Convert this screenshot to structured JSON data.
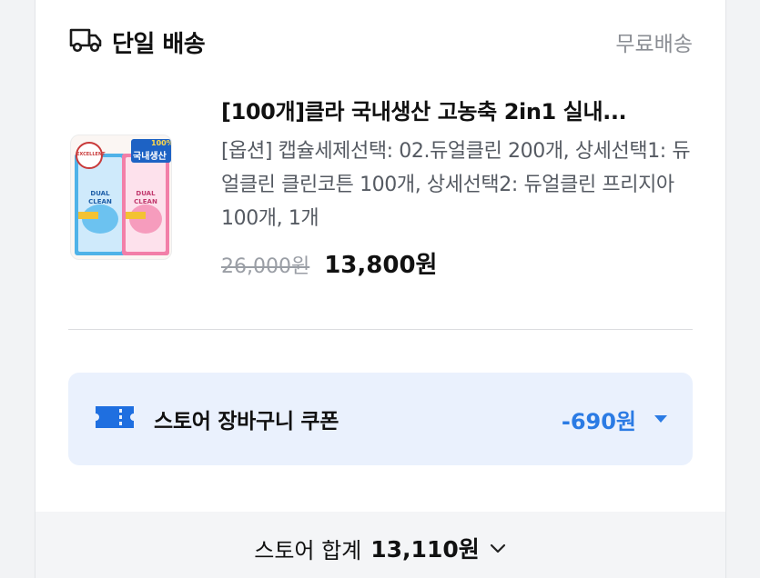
{
  "shipping": {
    "title": "단일 배송",
    "fee": "무료배송",
    "icon": "truck-icon"
  },
  "product": {
    "name": "[100개]클라 국내생산 고농축 2in1 실내...",
    "options": "[옵션] 캡슐세제선택: 02.듀얼클린 200개, 상세선택1: 듀얼클린 클린코튼 100개, 상세선택2: 듀얼클린 프리지아 100개, 1개",
    "original_price": "26,000원",
    "sale_price": "13,800원",
    "image": {
      "badge_top": "100%",
      "badge_main": "국내생산",
      "pack_text": "DUAL CLEAN",
      "seal": "EXCELLENT"
    }
  },
  "coupon": {
    "label": "스토어 장바구니 쿠폰",
    "amount": "-690원",
    "icon": "ticket-icon",
    "accent": "#2b7be4"
  },
  "footer": {
    "label": "스토어 합계",
    "amount": "13,110원",
    "icon": "chevron-down-icon"
  }
}
